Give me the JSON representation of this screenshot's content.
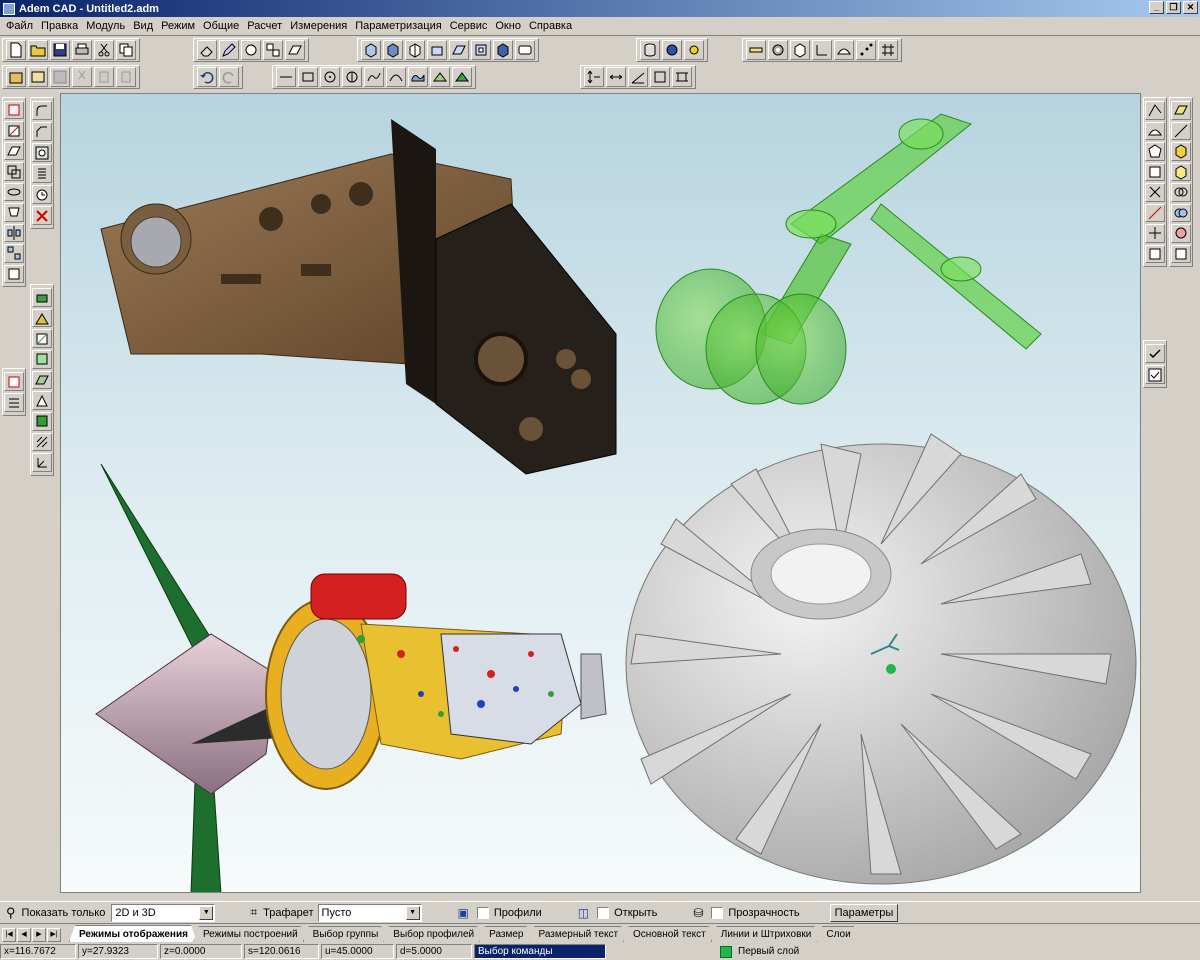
{
  "window": {
    "title": "Adem CAD - Untitled2.adm",
    "controls": [
      "_",
      "❐",
      "✕"
    ]
  },
  "menu": [
    "Файл",
    "Правка",
    "Модуль",
    "Вид",
    "Режим",
    "Общие",
    "Расчет",
    "Измерения",
    "Параметризация",
    "Сервис",
    "Окно",
    "Справка"
  ],
  "options_bar": {
    "show_only_label": "Показать только",
    "show_only_value": "2D и 3D",
    "template_label": "Трафарет",
    "template_value": "Пусто",
    "profiles_label": "Профили",
    "open_label": "Открыть",
    "transparency_label": "Прозрачность",
    "params_button": "Параметры"
  },
  "tabs": [
    "Режимы отображения",
    "Режимы построений",
    "Выбор группы",
    "Выбор профилей",
    "Размер",
    "Размерный текст",
    "Основной текст",
    "Линии и Штриховки",
    "Слои"
  ],
  "status": {
    "x": "x=116.7672",
    "y": "y=27.9323",
    "z": "z=0.0000",
    "s": "s=120.0616",
    "u": "u=45.0000",
    "d": "d=5.0000",
    "command": "Выбор команды",
    "layer": "Первый слой"
  },
  "colors": {
    "title_start": "#0a246a",
    "title_end": "#a6caf0",
    "layer": "#22b54a",
    "selection": "#0a246a"
  }
}
